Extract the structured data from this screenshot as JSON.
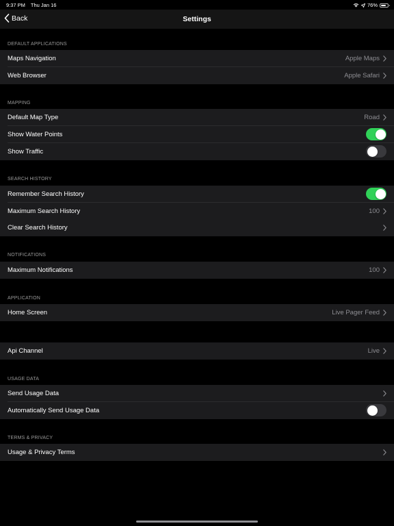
{
  "status": {
    "time": "9:37 PM",
    "date": "Thu Jan 16",
    "battery": "76%",
    "battery_level": 0.76
  },
  "nav": {
    "back_label": "Back",
    "title": "Settings"
  },
  "sections": {
    "default_apps": {
      "header": "DEFAULT APPLICATIONS",
      "maps_label": "Maps Navigation",
      "maps_value": "Apple Maps",
      "browser_label": "Web Browser",
      "browser_value": "Apple Safari"
    },
    "mapping": {
      "header": "MAPPING",
      "map_type_label": "Default Map Type",
      "map_type_value": "Road",
      "water_label": "Show Water Points",
      "water_on": true,
      "traffic_label": "Show Traffic",
      "traffic_on": false
    },
    "search_history": {
      "header": "SEARCH HISTORY",
      "remember_label": "Remember Search History",
      "remember_on": true,
      "max_label": "Maximum Search History",
      "max_value": "100",
      "clear_label": "Clear Search History"
    },
    "notifications": {
      "header": "NOTIFICATIONS",
      "max_label": "Maximum Notifications",
      "max_value": "100"
    },
    "application": {
      "header": "APPLICATION",
      "home_label": "Home Screen",
      "home_value": "Live Pager Feed"
    },
    "api": {
      "channel_label": "Api Channel",
      "channel_value": "Live"
    },
    "usage": {
      "header": "USAGE DATA",
      "send_label": "Send Usage Data",
      "auto_label": "Automatically Send Usage Data",
      "auto_on": false
    },
    "terms": {
      "header": "TERMS & PRIVACY",
      "terms_label": "Usage & Privacy Terms"
    }
  },
  "icons": {
    "back": "chevron-left-icon",
    "disclosure": "chevron-right-icon",
    "wifi": "wifi-icon",
    "location": "location-arrow-icon",
    "battery": "battery-icon"
  },
  "colors": {
    "background": "#000000",
    "cell": "#1c1c1e",
    "toggle_on": "#30d158",
    "toggle_off": "#39393d",
    "secondary_text": "#8e8e93"
  }
}
